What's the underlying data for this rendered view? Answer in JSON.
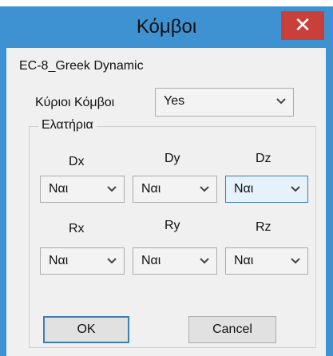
{
  "window": {
    "title": "Κόμβοι",
    "close_glyph": "✕"
  },
  "dialog": {
    "profile": "EC-8_Greek Dynamic",
    "main_nodes": {
      "label": "Κύριοι Κόμβοι",
      "value": "Yes"
    },
    "springs": {
      "title": "Ελατήρια",
      "dx": {
        "label": "Dx",
        "value": "Ναι"
      },
      "dy": {
        "label": "Dy",
        "value": "Ναι"
      },
      "dz": {
        "label": "Dz",
        "value": "Ναι"
      },
      "rx": {
        "label": "Rx",
        "value": "Ναι"
      },
      "ry": {
        "label": "Ry",
        "value": "Ναι"
      },
      "rz": {
        "label": "Rz",
        "value": "Ναι"
      }
    },
    "buttons": {
      "ok": "OK",
      "cancel": "Cancel"
    }
  },
  "colors": {
    "frame": "#3f92d2",
    "close": "#c9403b",
    "client": "#f0f0f0",
    "focus_border": "#3c7fb1"
  },
  "icons": {
    "dropdown": "chevron-down-icon",
    "close": "close-icon"
  }
}
